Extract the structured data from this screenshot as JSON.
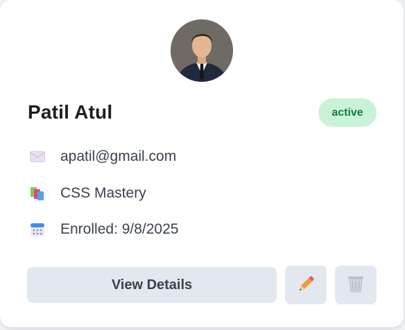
{
  "card": {
    "name": "Patil Atul",
    "status": "active",
    "email": "apatil@gmail.com",
    "course": "CSS Mastery",
    "enrolled": "Enrolled: 9/8/2025"
  },
  "icons": {
    "email": "envelope-icon",
    "course": "books-icon",
    "date": "calendar-icon",
    "edit": "pencil-icon",
    "delete": "wastebasket-icon"
  },
  "actions": {
    "view_label": "View Details"
  },
  "colors": {
    "badge_bg": "#c9f3d8",
    "badge_text": "#157a43",
    "button_bg": "#e3e8f0"
  }
}
